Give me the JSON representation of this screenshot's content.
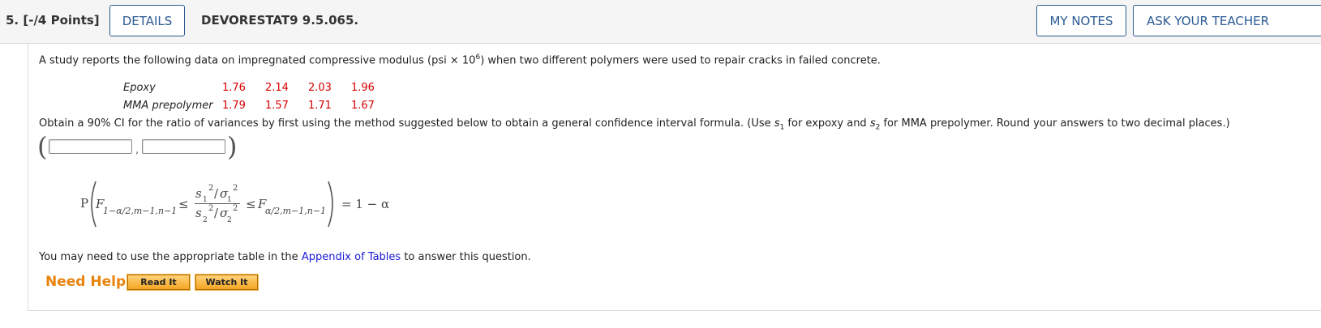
{
  "header": {
    "question_number": "5.",
    "points": "[-/4 Points]",
    "details_label": "DETAILS",
    "question_id": "DEVORESTAT9 9.5.065.",
    "my_notes_label": "MY NOTES",
    "ask_teacher_label": "ASK YOUR TEACHER"
  },
  "question": {
    "intro_before": "A study reports the following data on impregnated compressive modulus (psi × 10",
    "intro_exp": "6",
    "intro_after": ") when two different polymers were used to repair cracks in failed concrete.",
    "table": [
      {
        "label": "Epoxy",
        "values": [
          "1.76",
          "2.14",
          "2.03",
          "1.96"
        ]
      },
      {
        "label": "MMA prepolymer",
        "values": [
          "1.79",
          "1.57",
          "1.71",
          "1.67"
        ]
      }
    ],
    "instruction_part1": "Obtain a 90% CI for the ratio of variances by first using the method suggested below to obtain a general confidence interval formula. (Use ",
    "instruction_part2": " for expoxy and ",
    "instruction_part3": " for MMA prepolymer. Round your answers to two decimal places.)",
    "s_letter": "s",
    "sub1": "1",
    "sub2": "2",
    "answer": {
      "lower": "",
      "upper": "",
      "separator": ","
    },
    "formula": {
      "P": "P",
      "F": "F",
      "lower_sub": "1−α/2,m−1,n−1",
      "upper_sub": "α/2,m−1,n−1",
      "leq": "≤",
      "numerator": "s",
      "sigma": "σ",
      "slash": "/",
      "sq": "2",
      "rhs": "= 1 − α"
    },
    "table_note_before": "You may need to use the appropriate table in the ",
    "table_note_link": "Appendix of Tables",
    "table_note_after": " to answer this question."
  },
  "help": {
    "label": "Need Help?",
    "read_label": "Read It",
    "watch_label": "Watch It"
  }
}
